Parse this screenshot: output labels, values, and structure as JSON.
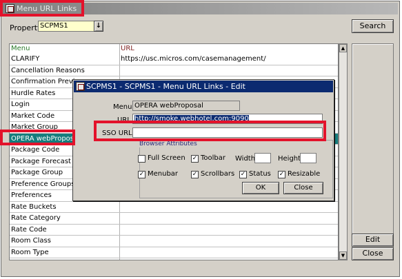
{
  "window": {
    "title": "Menu URL Links"
  },
  "property": {
    "label": "Property",
    "value": "SCPMS1",
    "dropdown_glyph": "↓"
  },
  "search_button": "Search",
  "grid": {
    "headers": {
      "menu": "Menu",
      "url": "URL"
    },
    "rows": [
      {
        "menu": "CLARIFY",
        "url": "https://usc.micros.com/casemanagement/"
      },
      {
        "menu": "Cancellation Reasons",
        "url": ""
      },
      {
        "menu": "Confirmation Previe",
        "url": ""
      },
      {
        "menu": "Hurdle Rates",
        "url": ""
      },
      {
        "menu": "Login",
        "url": ""
      },
      {
        "menu": "Market Code",
        "url": ""
      },
      {
        "menu": "Market Group",
        "url": ""
      },
      {
        "menu": "OPERA webPropos",
        "url": ""
      },
      {
        "menu": "Package Code",
        "url": ""
      },
      {
        "menu": "Package Forecast G",
        "url": ""
      },
      {
        "menu": "Package Group",
        "url": ""
      },
      {
        "menu": "Preference Groups",
        "url": ""
      },
      {
        "menu": "Preferences",
        "url": ""
      },
      {
        "menu": "Rate Buckets",
        "url": ""
      },
      {
        "menu": "Rate Category",
        "url": ""
      },
      {
        "menu": "Rate Code",
        "url": ""
      },
      {
        "menu": "Room Class",
        "url": ""
      },
      {
        "menu": "Room Type",
        "url": ""
      }
    ],
    "selected_row": 7
  },
  "side_buttons": {
    "edit": "Edit",
    "close": "Close"
  },
  "dialog": {
    "title": "SCPMS1 - SCPMS1 - Menu URL Links - Edit",
    "menu_label": "Menu",
    "menu_value": "OPERA webProposal",
    "url_label": "URL",
    "url_value": "http://smoke.webhotel.com:9090",
    "sso_label": "SSO URL",
    "sso_value": "",
    "browser_attributes_label": "Browser Attributes",
    "full_screen": {
      "label": "Full Screen",
      "checked": false
    },
    "toolbar": {
      "label": "Toolbar",
      "checked": true
    },
    "width_label": "Width",
    "width_value": "",
    "height_label": "Height",
    "height_value": "",
    "menubar": {
      "label": "Menubar",
      "checked": true
    },
    "scrollbars": {
      "label": "Scrollbars",
      "checked": true
    },
    "status": {
      "label": "Status",
      "checked": true
    },
    "resizable": {
      "label": "Resizable",
      "checked": true
    },
    "ok_button": "OK",
    "close_button": "Close"
  },
  "colors": {
    "highlight_border": "#e3122b",
    "selected_row": "#157c7c",
    "dialog_title": "#0b2a70"
  }
}
